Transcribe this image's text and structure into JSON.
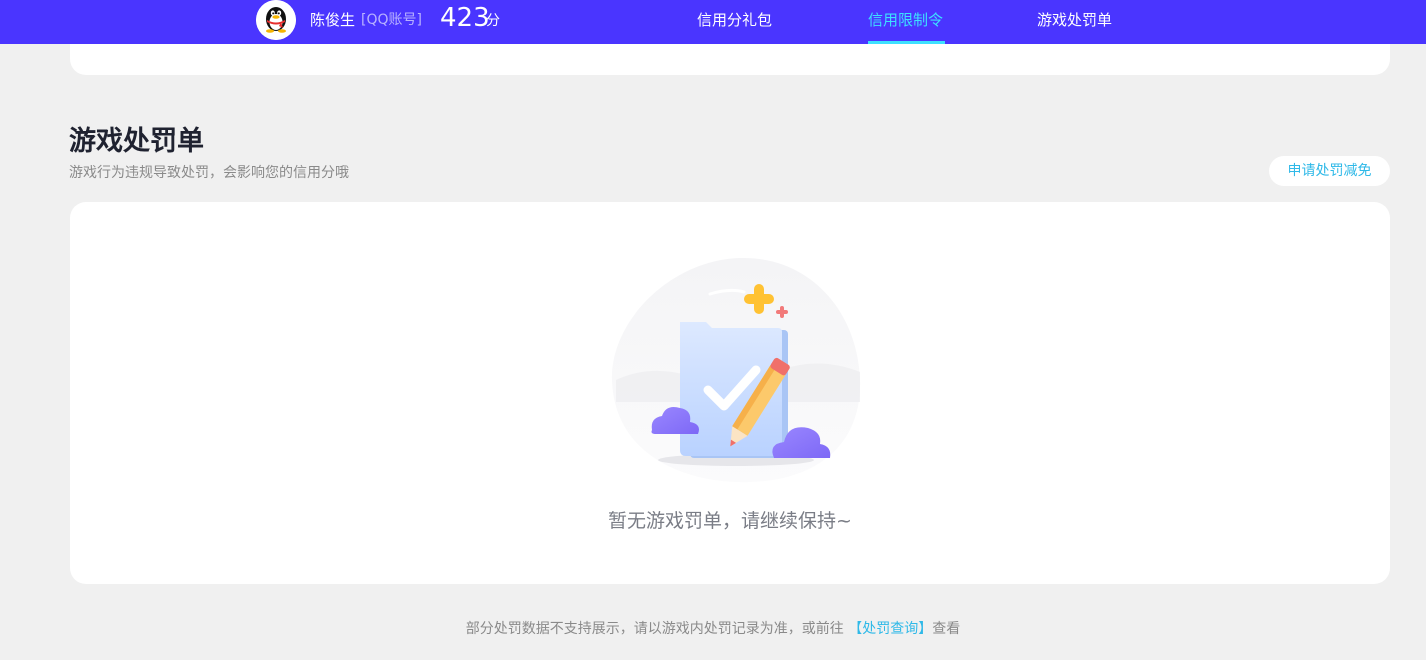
{
  "header": {
    "user_name": "陈俊生",
    "account_type": "[QQ账号]",
    "score_value": "423",
    "score_unit": "分",
    "avatar_icon": "qq-penguin-icon",
    "tabs": [
      {
        "label": "信用分礼包",
        "active": false
      },
      {
        "label": "信用限制令",
        "active": true
      },
      {
        "label": "游戏处罚单",
        "active": false
      }
    ],
    "colors": {
      "bar": "#4a35ff",
      "active_tab": "#3de0ff"
    }
  },
  "section": {
    "title": "游戏处罚单",
    "subtitle": "游戏行为违规导致处罚，会影响您的信用分哦",
    "appeal_button": "申请处罚减免"
  },
  "empty_state": {
    "icon": "empty-checklist-pencil-icon",
    "message": "暂无游戏罚单，请继续保持~"
  },
  "footer": {
    "note_prefix": "部分处罚数据不支持展示，请以游戏内处罚记录为准，或前往",
    "link_text": "【处罚查询】",
    "note_suffix": "查看",
    "link_color": "#2fb9e8"
  }
}
